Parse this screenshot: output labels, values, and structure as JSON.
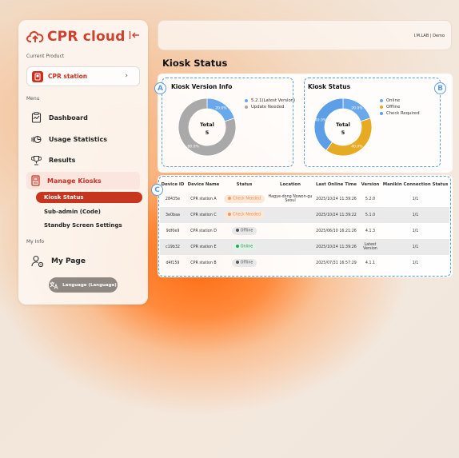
{
  "app": {
    "name": "CPR cloud",
    "brand_color": "#d1402c"
  },
  "sidebar": {
    "current_product_label": "Current Product",
    "product": "CPR station",
    "menu_label": "Menu",
    "items": [
      {
        "label": "Dashboard",
        "icon": "dashboard-icon"
      },
      {
        "label": "Usage Statistics",
        "icon": "usage-statistics-icon"
      },
      {
        "label": "Results",
        "icon": "trophy-icon"
      },
      {
        "label": "Manage Kiosks",
        "icon": "kiosk-icon"
      }
    ],
    "sub_items": [
      {
        "label": "Kiosk Status",
        "active": true
      },
      {
        "label": "Sub-admin (Code)"
      },
      {
        "label": "Standby Screen Settings"
      }
    ],
    "my_info_label": "My Info",
    "my_page": "My Page",
    "language_button": "Language (Language)"
  },
  "topbar": {
    "right_text": "I.M.LAB | Demo"
  },
  "page_title": "Kiosk Status",
  "annotations": {
    "a": "A",
    "b": "B",
    "c": "C"
  },
  "version_card": {
    "title": "Kiosk Version Info",
    "legend": [
      "5.2.1(Latest Version)",
      "Update Needed"
    ],
    "center_label": "Total",
    "center_value": "5",
    "slices": [
      {
        "name": "5.2.1(Latest Version)",
        "value": 20,
        "label": "20.0%",
        "color": "#6aa8ec"
      },
      {
        "name": "Update Needed",
        "value": 80,
        "label": "80.0%",
        "color": "#a9a9a9"
      }
    ]
  },
  "status_card": {
    "title": "Kiosk Status",
    "legend": [
      "Online",
      "Offline",
      "Check Required"
    ],
    "center_label": "Total",
    "center_value": "5",
    "slices": [
      {
        "name": "Online",
        "value": 20,
        "label": "20.0%",
        "color": "#6aa8ec"
      },
      {
        "name": "Offline",
        "value": 40,
        "label": "40.0%",
        "color": "#e6ab22"
      },
      {
        "name": "Check Required",
        "value": 40,
        "label": "40.0%",
        "color": "#5c9fe6"
      }
    ]
  },
  "table": {
    "headers": [
      "Device ID",
      "Device Name",
      "Status",
      "Location",
      "Last Online Time",
      "Version",
      "Manikin Connection Status"
    ],
    "rows": [
      {
        "id": "28435e",
        "name": "CPR station A",
        "status": "Check Needed",
        "status_type": "warn",
        "location": "Hagye-dong Nowon-gu Seoul",
        "last_online": "2025/10/24 11:39:26",
        "version": "5.2.0",
        "manikin": "1/1"
      },
      {
        "id": "3e0baa",
        "name": "CPR station C",
        "status": "Check Needed",
        "status_type": "warn",
        "location": "",
        "last_online": "2025/10/24 11:39:22",
        "version": "5.1.0",
        "manikin": "1/1"
      },
      {
        "id": "9df0e9",
        "name": "CPR station D",
        "status": "Offline",
        "status_type": "offline",
        "location": "",
        "last_online": "2025/06/10 16:21:26",
        "version": "4.1.3",
        "manikin": "1/1"
      },
      {
        "id": "c19b32",
        "name": "CPR station E",
        "status": "Online",
        "status_type": "online",
        "location": "",
        "last_online": "2025/10/24 11:39:26",
        "version": "Latest Version",
        "manikin": "1/1"
      },
      {
        "id": "d4f159",
        "name": "CPR station B",
        "status": "Offline",
        "status_type": "offline",
        "location": "",
        "last_online": "2025/07/31 16:57:29",
        "version": "4.1.1",
        "manikin": "1/1"
      }
    ]
  }
}
